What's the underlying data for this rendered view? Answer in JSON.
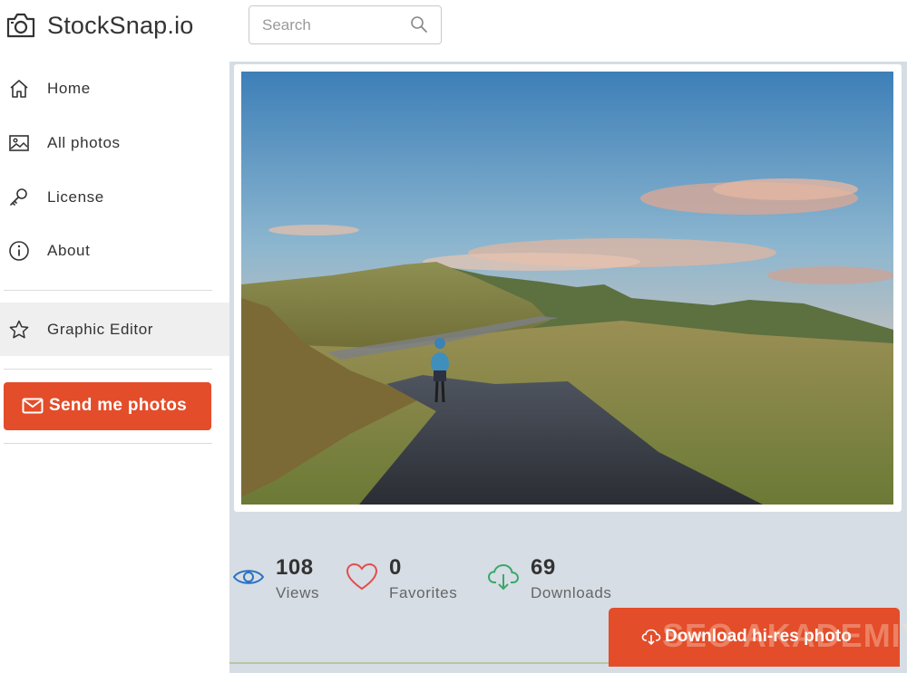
{
  "brand": {
    "name": "StockSnap.io"
  },
  "search": {
    "placeholder": "Search"
  },
  "sidebar": {
    "items": [
      {
        "label": "Home",
        "icon": "home-icon"
      },
      {
        "label": "All photos",
        "icon": "image-icon"
      },
      {
        "label": "License",
        "icon": "key-icon"
      },
      {
        "label": "About",
        "icon": "info-icon"
      },
      {
        "label": "Graphic Editor",
        "icon": "star-icon",
        "active": true
      }
    ],
    "send_button": {
      "label": "Send me photos",
      "icon": "mail-icon"
    }
  },
  "stats": [
    {
      "value": "108",
      "label": "Views",
      "icon": "eye-icon",
      "color": "#2a72c4"
    },
    {
      "value": "0",
      "label": "Favorites",
      "icon": "heart-icon",
      "color": "#e34d4d"
    },
    {
      "value": "69",
      "label": "Downloads",
      "icon": "cloud-download-icon",
      "color": "#3aa86b"
    }
  ],
  "download_button": {
    "label": "Download hi-res photo",
    "icon": "cloud-download-icon"
  },
  "watermark": {
    "text": "SEO AKADEMIYA"
  },
  "colors": {
    "accent": "#e34d2a",
    "main_bg": "#d6dde4"
  }
}
